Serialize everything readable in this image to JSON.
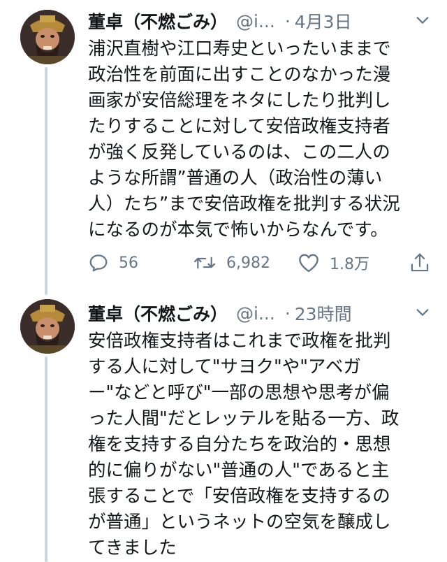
{
  "tweets": [
    {
      "display_name": "董卓（不燃ごみ）",
      "handle": "@i...",
      "separator": "·",
      "time": "4月3日",
      "text_lines": [
        "浦沢直樹や江口寿史といったいままで",
        "政治性を前面に出すことのなかった漫",
        "画家が安倍総理をネタにしたり批判し",
        "たりすることに対して安倍政権支持者",
        "が強く反発しているのは、この二人の",
        "ような所謂”普通の人（政治性の薄い",
        "人）たち”まで安倍政権を批判する状況",
        "になるのが本気で怖いからなんです。"
      ],
      "replies": "56",
      "retweets": "6,982",
      "likes": "1.8万"
    },
    {
      "display_name": "董卓（不燃ごみ）",
      "handle": "@i...",
      "separator": "·",
      "time": "23時間",
      "text_lines": [
        "安倍政権支持者はこれまで政権を批判",
        "する人に対して\"サヨク\"や\"アベガ",
        "ー\"などと呼び\"一部の思想や思考が偏",
        "った人間\"だとレッテルを貼る一方、政",
        "権を支持する自分たちを政治的・思想",
        "的に偏りがない\"普通の人\"であると主",
        "張することで「安倍政権を支持するの",
        "が普通」というネットの空気を醸成し",
        "てきました"
      ]
    }
  ],
  "icons": {
    "avatar": "avatar-image",
    "caret": "chevron-down-icon",
    "reply": "reply-icon",
    "retweet": "retweet-icon",
    "like": "heart-icon",
    "share": "share-icon"
  },
  "colors": {
    "text": "#14171a",
    "secondary": "#657786",
    "thread_line": "#ccd6dd"
  }
}
